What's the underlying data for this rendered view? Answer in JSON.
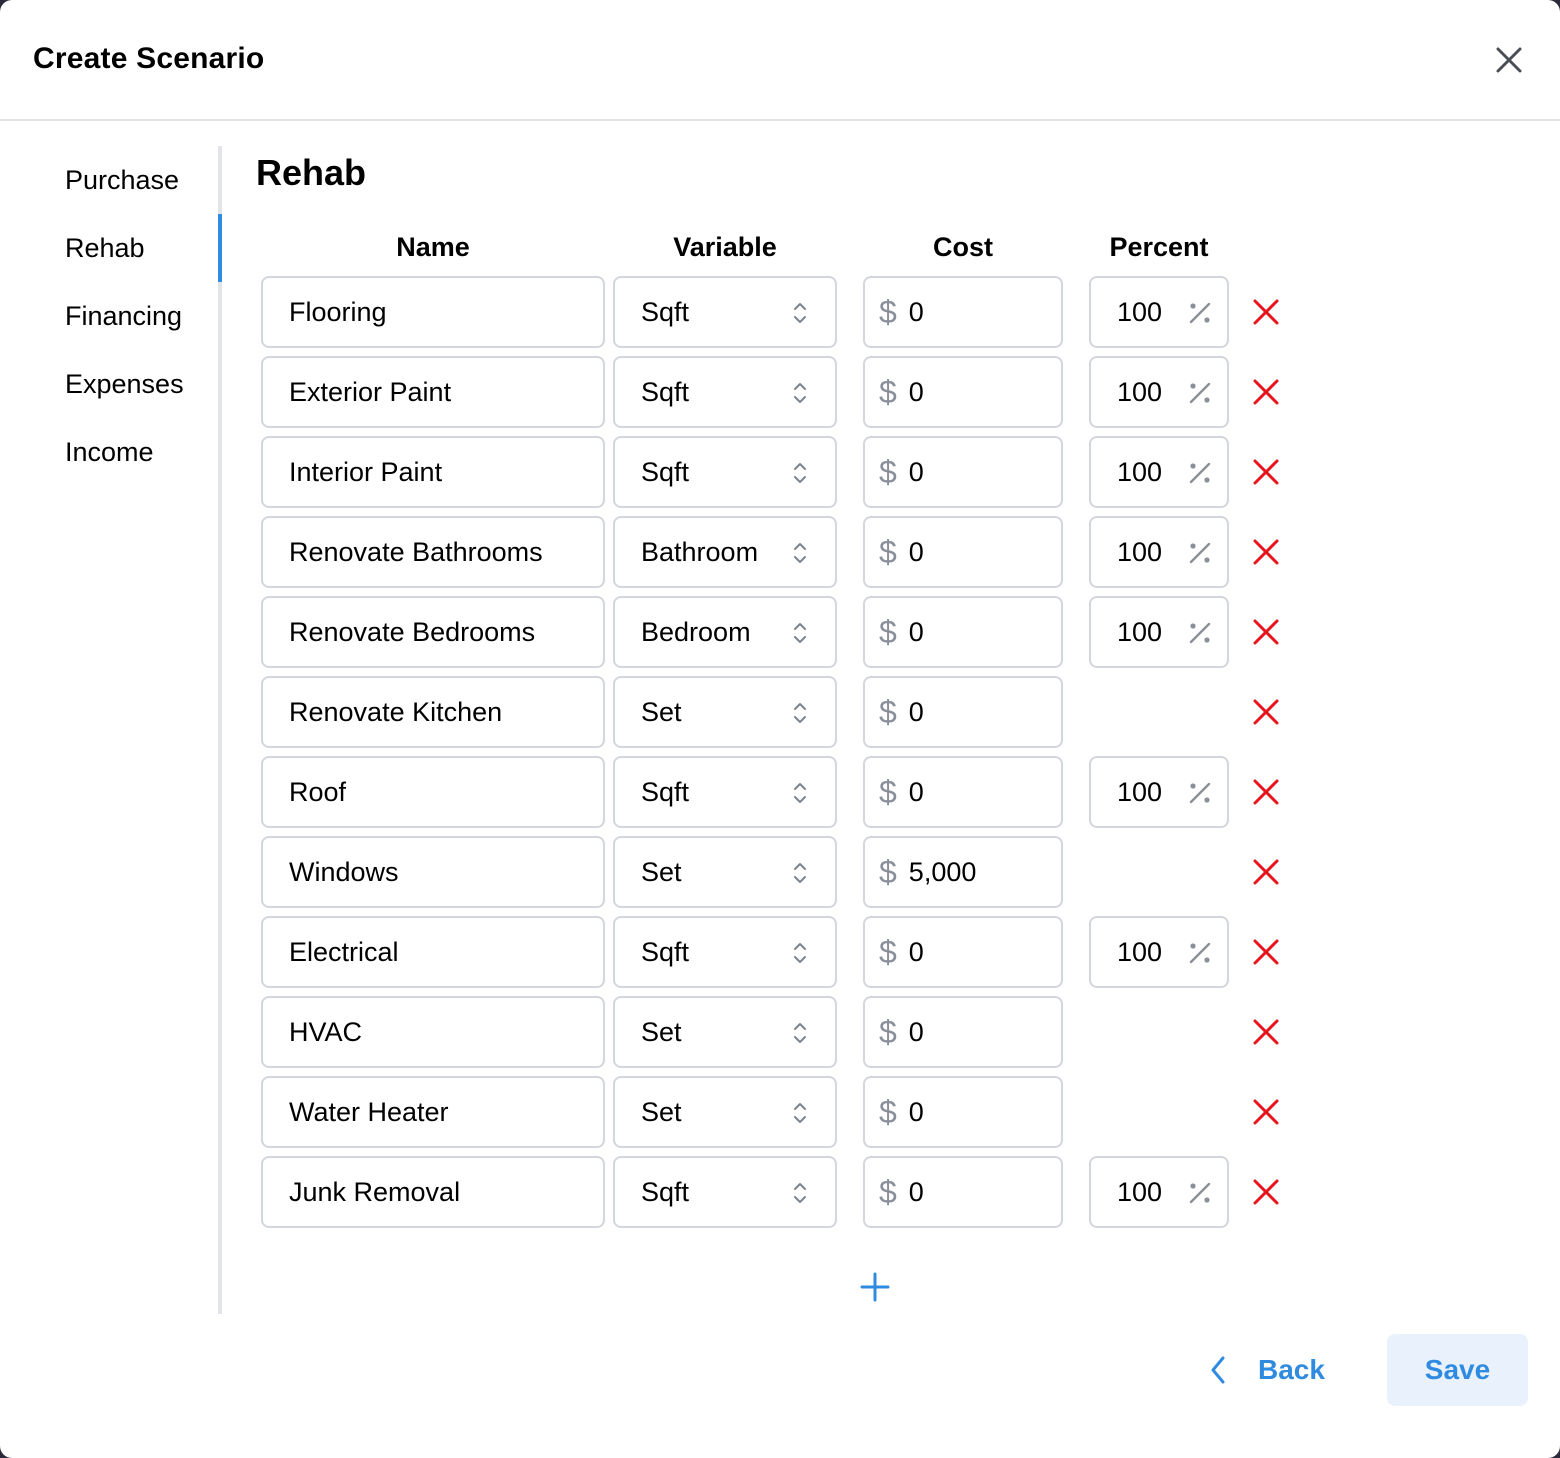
{
  "dialog": {
    "title": "Create Scenario",
    "close_icon": "close-icon"
  },
  "sidebar": {
    "active": "Rehab",
    "items": [
      {
        "label": "Purchase"
      },
      {
        "label": "Rehab"
      },
      {
        "label": "Financing"
      },
      {
        "label": "Expenses"
      },
      {
        "label": "Income"
      }
    ]
  },
  "section": {
    "title": "Rehab",
    "columns": {
      "name": "Name",
      "variable": "Variable",
      "cost": "Cost",
      "percent": "Percent"
    },
    "currency_symbol": "$",
    "rows": [
      {
        "name": "Flooring",
        "variable": "Sqft",
        "cost": "0",
        "percent": "100"
      },
      {
        "name": "Exterior Paint",
        "variable": "Sqft",
        "cost": "0",
        "percent": "100"
      },
      {
        "name": "Interior Paint",
        "variable": "Sqft",
        "cost": "0",
        "percent": "100"
      },
      {
        "name": "Renovate Bathrooms",
        "variable": "Bathroom",
        "cost": "0",
        "percent": "100"
      },
      {
        "name": "Renovate Bedrooms",
        "variable": "Bedroom",
        "cost": "0",
        "percent": "100"
      },
      {
        "name": "Renovate Kitchen",
        "variable": "Set",
        "cost": "0",
        "percent": null
      },
      {
        "name": "Roof",
        "variable": "Sqft",
        "cost": "0",
        "percent": "100"
      },
      {
        "name": "Windows",
        "variable": "Set",
        "cost": "5,000",
        "percent": null
      },
      {
        "name": "Electrical",
        "variable": "Sqft",
        "cost": "0",
        "percent": "100"
      },
      {
        "name": "HVAC",
        "variable": "Set",
        "cost": "0",
        "percent": null
      },
      {
        "name": "Water Heater",
        "variable": "Set",
        "cost": "0",
        "percent": null
      },
      {
        "name": "Junk Removal",
        "variable": "Sqft",
        "cost": "0",
        "percent": "100"
      }
    ]
  },
  "footer": {
    "back_label": "Back",
    "save_label": "Save"
  },
  "colors": {
    "accent": "#2f8be0",
    "delete": "#e8141c",
    "save_bg": "#e9f2fc"
  }
}
